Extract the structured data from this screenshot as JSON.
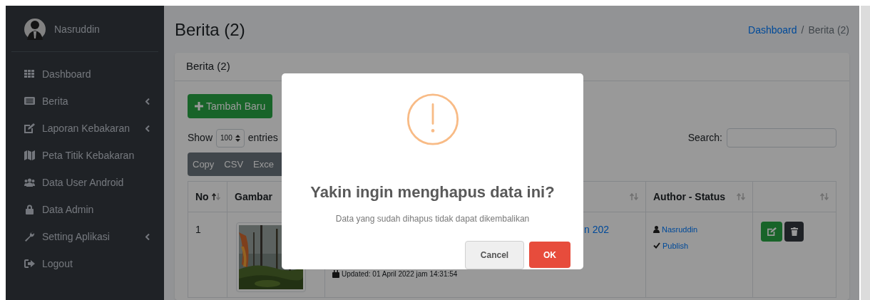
{
  "user": {
    "name": "Nasruddin"
  },
  "sidebar": {
    "items": [
      {
        "label": "Dashboard",
        "kind": "grid",
        "expandable": false
      },
      {
        "label": "Berita",
        "kind": "newspaper",
        "expandable": true
      },
      {
        "label": "Laporan Kebakaran",
        "kind": "edit",
        "expandable": true
      },
      {
        "label": "Peta Titik Kebakaran",
        "kind": "map",
        "expandable": false
      },
      {
        "label": "Data User Android",
        "kind": "users",
        "expandable": false
      },
      {
        "label": "Data Admin",
        "kind": "lock",
        "expandable": false
      },
      {
        "label": "Setting Aplikasi",
        "kind": "wrench",
        "expandable": true
      },
      {
        "label": "Logout",
        "kind": "logout",
        "expandable": false
      }
    ]
  },
  "page": {
    "title": "Berita (2)",
    "breadcrumb_separator": "/",
    "breadcrumb": [
      {
        "label": "Dashboard",
        "link": true
      },
      {
        "label": "Berita (2)",
        "link": false
      }
    ]
  },
  "card": {
    "title": "Berita (2)",
    "add_button": "Tambah Baru",
    "length": {
      "show": "Show",
      "value": "100",
      "entries": "entries"
    },
    "search": {
      "label": "Search:"
    },
    "export_buttons": [
      "Copy",
      "CSV",
      "Exce"
    ]
  },
  "table": {
    "columns": [
      {
        "label": "No",
        "kind": "sorted"
      },
      {
        "label": "Gambar",
        "kind": "plain"
      },
      {
        "kind": "sortable"
      },
      {
        "label": "Author - Status",
        "kind": "sortable"
      },
      {
        "kind": "sortable"
      }
    ],
    "rows": [
      {
        "no": "1",
        "title": "n 202",
        "updated": "Updated: 01 April 2022 jam 14:31:54",
        "author": "Nasruddin",
        "status": "Publish"
      }
    ]
  },
  "dialog": {
    "title": "Yakin ingin menghapus data ini?",
    "text": "Data yang sudah dihapus tidak dapat dikembalikan",
    "cancel": "Cancel",
    "confirm": "OK"
  }
}
